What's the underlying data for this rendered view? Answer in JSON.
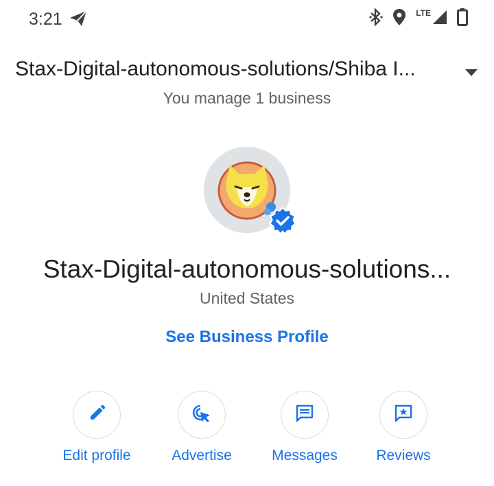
{
  "status_bar": {
    "time": "3:21",
    "network": "LTE",
    "icons": [
      "telegram-send-icon",
      "bluetooth-icon",
      "location-icon",
      "signal-icon",
      "battery-icon"
    ]
  },
  "account": {
    "name": "Stax-Digital-autonomous-solutions/Shiba I...",
    "manage_text": "You manage 1 business"
  },
  "business": {
    "name": "Stax-Digital-autonomous-solutions...",
    "location": "United States",
    "profile_link": "See Business Profile",
    "verified": true
  },
  "actions": [
    {
      "label": "Edit profile",
      "icon": "pencil-icon"
    },
    {
      "label": "Advertise",
      "icon": "advertise-click-icon"
    },
    {
      "label": "Messages",
      "icon": "message-icon"
    },
    {
      "label": "Reviews",
      "icon": "review-star-icon"
    }
  ],
  "colors": {
    "accent": "#1a73e8",
    "text_primary": "#202124",
    "text_secondary": "#5f6368",
    "border": "#dadce0"
  }
}
